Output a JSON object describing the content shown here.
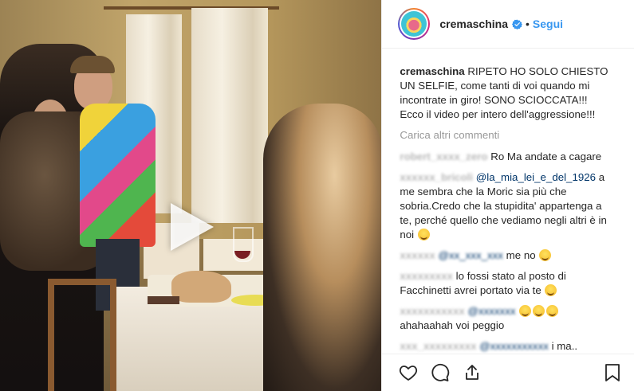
{
  "account": {
    "username": "cremaschina",
    "verified": true,
    "separator": "•",
    "follow_label": "Segui"
  },
  "caption": {
    "username": "cremaschina",
    "text": "RIPETO HO SOLO CHIESTO UN SELFIE, come tanti di voi quando mi incontrate in giro! SONO SCIOCCATA!!! Ecco il video per intero dell'aggressione!!!"
  },
  "load_more_label": "Carica altri commenti",
  "comments": [
    {
      "username": "robert_xxxx_zero",
      "text_before": " Ro Ma andate a cagare",
      "mention": "",
      "text_after": ""
    },
    {
      "username": "xxxxxx_bricoli",
      "text_before": " ",
      "mention": "@la_mia_lei_e_del_1926",
      "text_after": " a me sembra che la Moric sia più che sobria.Credo che la stupidita' appartenga a te, perché quello che vediamo negli altri è in noi"
    },
    {
      "username": "xxxxxx",
      "text_before": " ",
      "mention": "@xx_xxx_xxx",
      "text_after": " me no"
    },
    {
      "username": "xxxxxxxxx",
      "text_before": " lo fossi stato al posto di Facchinetti avrei portato via te",
      "mention": "",
      "text_after": ""
    },
    {
      "username": "xxxxxxxxxxx",
      "text_before": " ",
      "mention": "@xxxxxxx",
      "text_after": " "
    },
    {
      "username": "",
      "text_before": "ahahaahah voi peggio",
      "mention": "",
      "text_after": ""
    },
    {
      "username": "xxx_xxxxxxxxx",
      "text_before": " ",
      "mention": "@xxxxxxxxxxx",
      "text_after": " i ma.. vabbe ahaha"
    }
  ],
  "icons": {
    "like": "heart-icon",
    "comment": "comment-icon",
    "share": "share-icon",
    "save": "bookmark-icon",
    "play": "play-icon",
    "verified": "verified-badge-icon"
  },
  "colors": {
    "link": "#3897f0",
    "mention": "#003569",
    "muted": "#999999",
    "text": "#262626"
  }
}
